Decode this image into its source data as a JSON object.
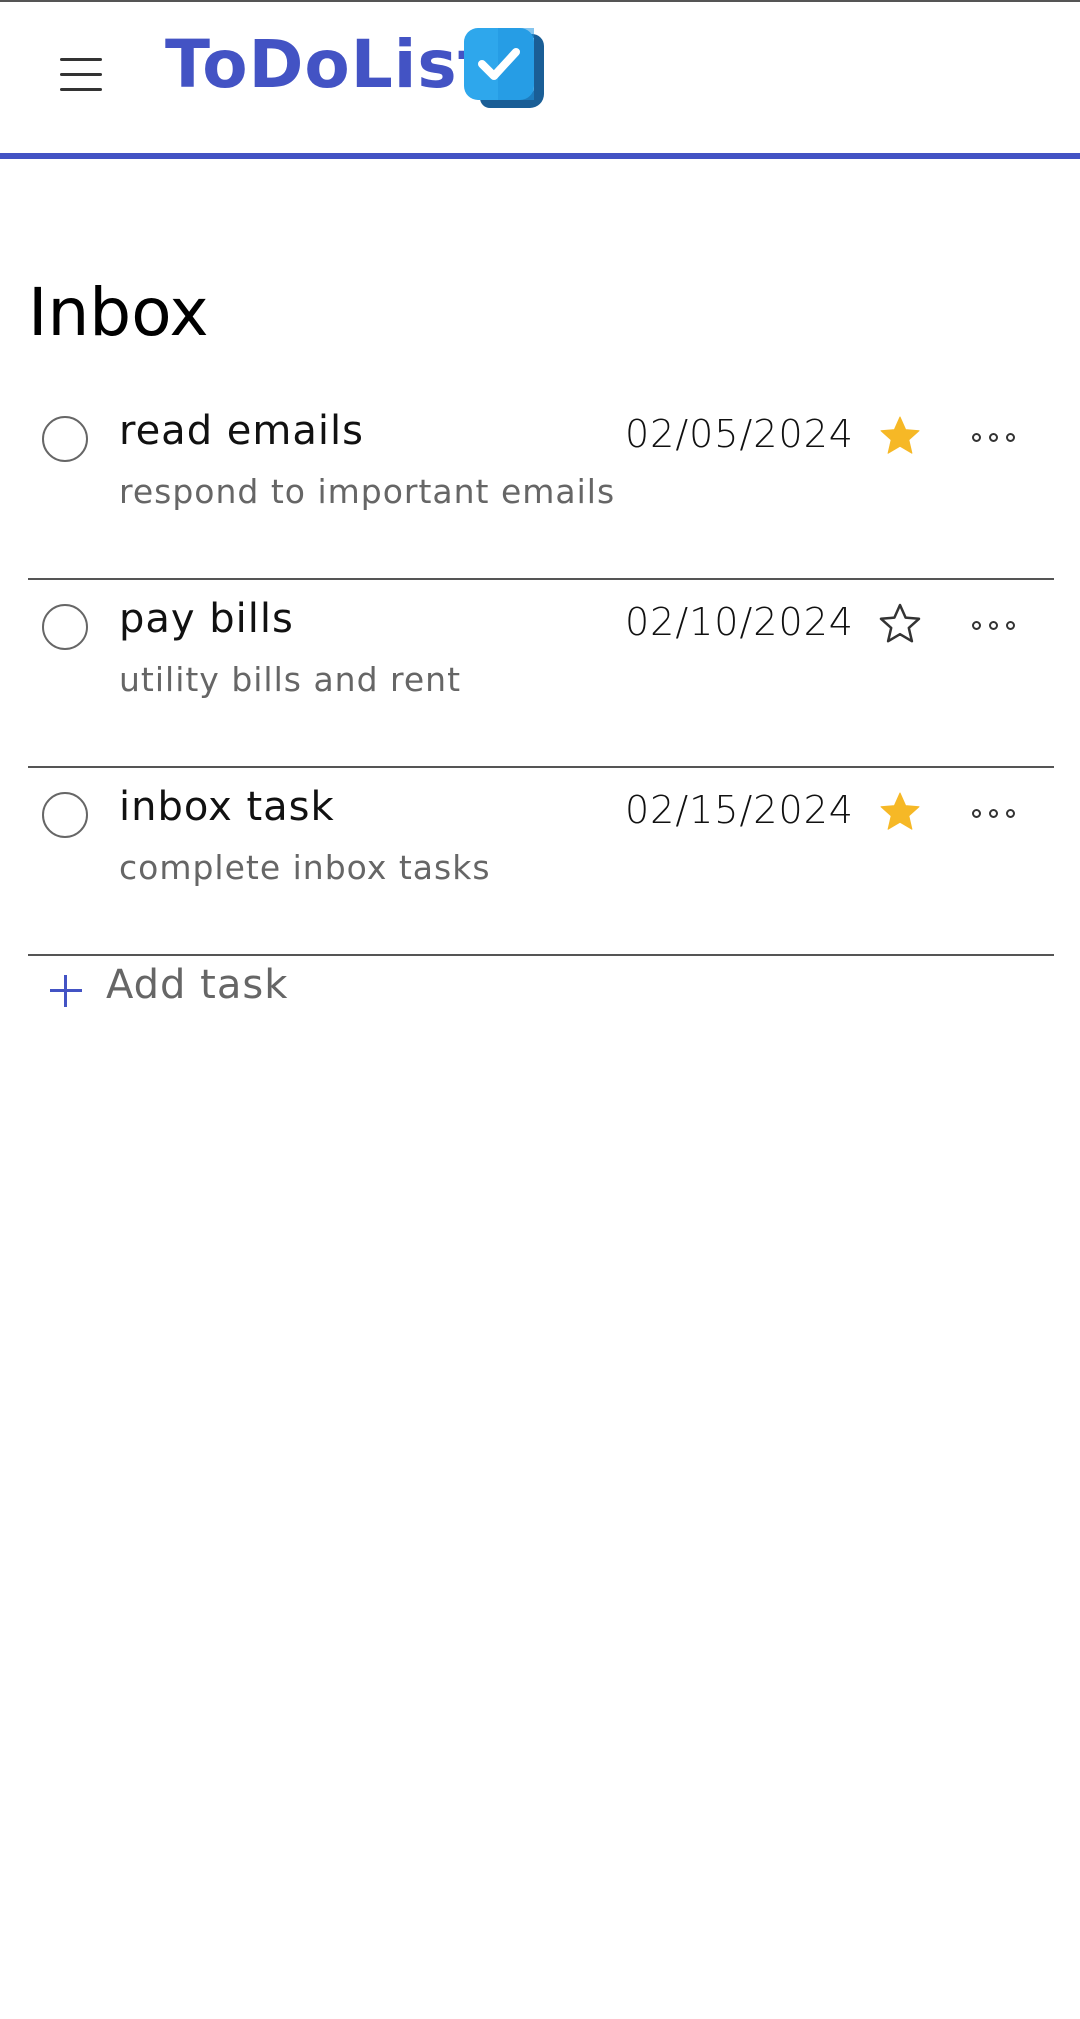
{
  "app": {
    "name": "ToDoList",
    "brand_color": "#4353c4",
    "logo_icon": "checkbox-logo-icon"
  },
  "header": {
    "menu_icon": "hamburger-menu-icon"
  },
  "page": {
    "title": "Inbox"
  },
  "tasks": [
    {
      "title": "read emails",
      "description": "respond to important emails",
      "date": "02/05/2024",
      "starred": true
    },
    {
      "title": "pay bills",
      "description": "utility bills and rent",
      "date": "02/10/2024",
      "starred": false
    },
    {
      "title": "inbox task",
      "description": "complete inbox tasks",
      "date": "02/15/2024",
      "starred": true
    }
  ],
  "add_task": {
    "label": "Add task"
  },
  "colors": {
    "star_filled": "#f6b826",
    "star_outline": "#333333"
  }
}
